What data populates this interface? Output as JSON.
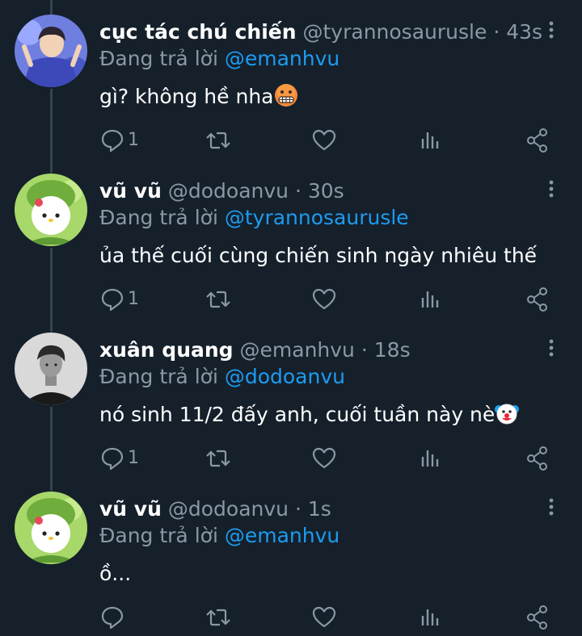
{
  "colors": {
    "background": "#15202b",
    "name": "#ffffff",
    "secondary_text": "#8b98a5",
    "mention": "#1d9bf0",
    "thread_line": "#38444d"
  },
  "icons": [
    "reply-icon",
    "retweet-icon",
    "like-icon",
    "views-icon",
    "share-icon",
    "more-icon"
  ],
  "tweets": [
    {
      "name": "cục tác chú chiến",
      "handle": "@tyrannosaurusle",
      "separator": "·",
      "time": "43s",
      "reply_prefix": "Đang trả lời",
      "reply_to": "@emanhvu",
      "text": "gì? không hề nha",
      "emoji": "grimacing-face-emoji",
      "reply_count": "1"
    },
    {
      "name": "vũ vũ",
      "handle": "@dodoanvu",
      "separator": "·",
      "time": "30s",
      "reply_prefix": "Đang trả lời",
      "reply_to": "@tyrannosaurusle",
      "text": "ủa thế cuối cùng chiến sinh ngày nhiêu thế",
      "emoji": "",
      "reply_count": "1"
    },
    {
      "name": "xuân quang",
      "handle": "@emanhvu",
      "separator": "·",
      "time": "18s",
      "reply_prefix": "Đang trả lời",
      "reply_to": "@dodoanvu",
      "text": "nó sinh 11/2 đấy anh, cuối tuần này nè",
      "emoji": "clown-face-emoji",
      "reply_count": "1"
    },
    {
      "name": "vũ vũ",
      "handle": "@dodoanvu",
      "separator": "·",
      "time": "1s",
      "reply_prefix": "Đang trả lời",
      "reply_to": "@emanhvu",
      "text": "ồ...",
      "emoji": "",
      "reply_count": ""
    }
  ]
}
